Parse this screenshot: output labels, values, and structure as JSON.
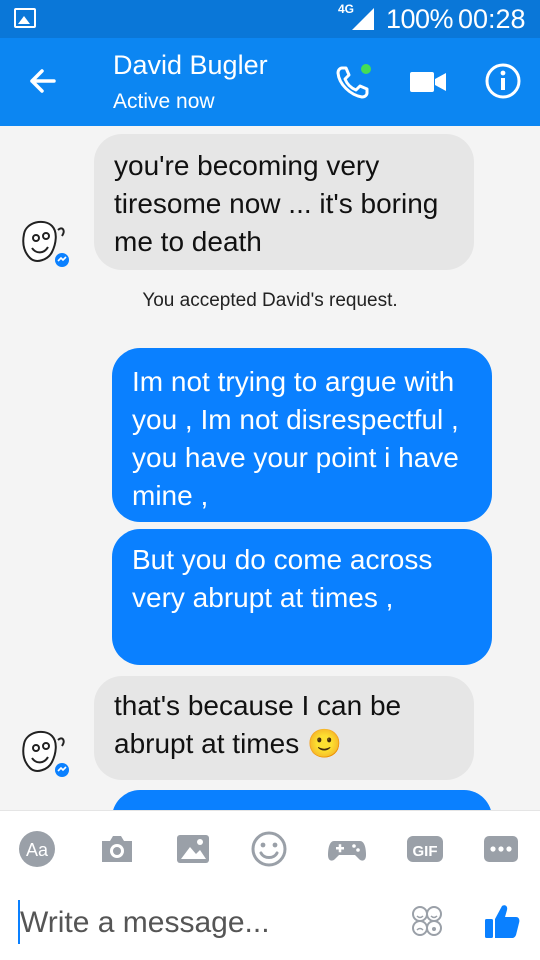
{
  "status_bar": {
    "network": "4G",
    "battery": "100%",
    "time": "00:28"
  },
  "header": {
    "name": "David Bugler",
    "status": "Active now"
  },
  "messages": [
    {
      "from": "them",
      "text": "you're becoming very tiresome now ... it's boring me to death"
    },
    {
      "type": "system",
      "text": "You accepted David's request."
    },
    {
      "from": "me",
      "text": "Im not trying to argue with you , Im not disrespectful , you have your point i have mine ,"
    },
    {
      "from": "me",
      "text": "But you do come across very abrupt at times ,"
    },
    {
      "from": "them",
      "text": "that's because I can be abrupt at times",
      "emoji": "🙂"
    }
  ],
  "toolbar": {
    "aa_label": "Aa",
    "gif_label": "GIF"
  },
  "composer": {
    "placeholder": "Write a message..."
  },
  "colors": {
    "accent": "#0c86f2",
    "status_bar": "#0a77d8",
    "outgoing": "#0a80ff",
    "incoming": "#e6e6e6"
  }
}
